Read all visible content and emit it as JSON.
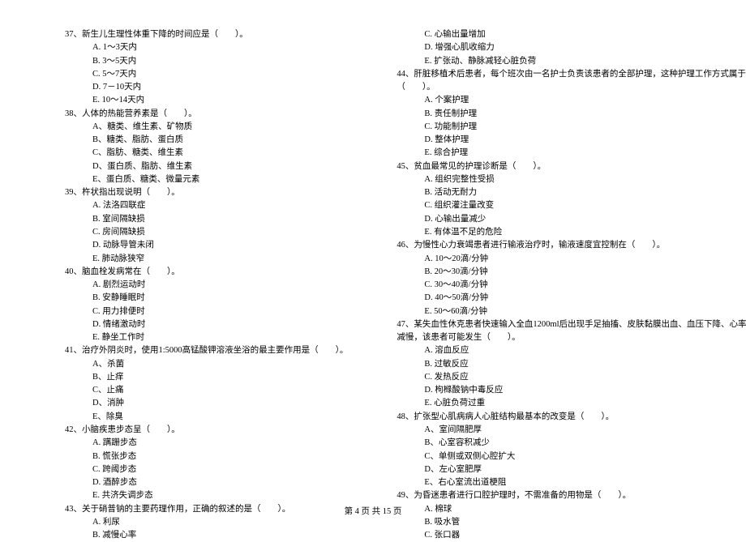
{
  "left": {
    "q37": {
      "text": "37、新生儿生理性体重下降的时间应是（　　）。",
      "opts": [
        "A. 1～3天内",
        "B. 3～5天内",
        "C. 5～7天内",
        "D. 7－10天内",
        "E. 10～14天内"
      ]
    },
    "q38": {
      "text": "38、人体的热能营养素是（　　）。",
      "opts": [
        "A、糖类、维生素、矿物质",
        "B、糖类、脂肪、蛋白质",
        "C、脂肪、糖类、维生素",
        "D、蛋白质、脂肪、维生素",
        "E、蛋白质、糖类、微量元素"
      ]
    },
    "q39": {
      "text": "39、杵状指出现说明（　　）。",
      "opts": [
        "A. 法洛四联症",
        "B. 室间隔缺损",
        "C. 房间隔缺损",
        "D. 动脉导管未闭",
        "E. 肺动脉狭窄"
      ]
    },
    "q40": {
      "text": "40、脑血栓发病常在（　　）。",
      "opts": [
        "A. 剧烈运动时",
        "B. 安静睡眠时",
        "C. 用力排便时",
        "D. 情绪激动时",
        "E. 静坐工作时"
      ]
    },
    "q41": {
      "text": "41、治疗外阴炎时，使用1:5000高锰酸钾溶液坐浴的最主要作用是（　　）。",
      "opts": [
        "A、杀菌",
        "B、止痒",
        "C、止痛",
        "D、消肿",
        "E、除臭"
      ]
    },
    "q42": {
      "text": "42、小脑疾患步态呈（　　）。",
      "opts": [
        "A. 蹒跚步态",
        "B. 慌张步态",
        "C. 跨阈步态",
        "D. 酒醉步态",
        "E. 共济失调步态"
      ]
    },
    "q43": {
      "text": "43、关于硝普钠的主要药理作用，正确的叙述的是（　　）。",
      "opts": [
        "A. 利尿",
        "B. 减慢心率"
      ]
    }
  },
  "right": {
    "q43c": [
      "C. 心输出量增加",
      "D. 增强心肌收缩力",
      "E. 扩张动、静脉减轻心脏负荷"
    ],
    "q44": {
      "text": "44、肝脏移植术后患者，每个班次由一名护士负责该患者的全部护理，这种护理工作方式属于",
      "text2": "（　　）。",
      "opts": [
        "A. 个案护理",
        "B. 责任制护理",
        "C. 功能制护理",
        "D. 整体护理",
        "E. 综合护理"
      ]
    },
    "q45": {
      "text": "45、贫血最常见的护理诊断是（　　）。",
      "opts": [
        "A. 组织完整性受损",
        "B. 活动无耐力",
        "C. 组织灌注量改变",
        "D. 心输出量减少",
        "E. 有体温不足的危险"
      ]
    },
    "q46": {
      "text": "46、为慢性心力衰竭患者进行输液治疗时，输液速度宜控制在（　　）。",
      "opts": [
        "A. 10～20滴/分钟",
        "B. 20～30滴/分钟",
        "C. 30～40滴/分钟",
        "D. 40～50滴/分钟",
        "E. 50～60滴/分钟"
      ]
    },
    "q47": {
      "text": "47、某失血性休克患者快速输入全血1200ml后出现手足抽搐、皮肤黏膜出血、血压下降、心率",
      "text2": "减慢，该患者可能发生（　　）。",
      "opts": [
        "A. 溶血反应",
        "B. 过敏反应",
        "C. 发热反应",
        "D. 枸橼酸钠中毒反应",
        "E. 心脏负荷过重"
      ]
    },
    "q48": {
      "text": "48、扩张型心肌病病人心脏结构最基本的改变是（　　）。",
      "opts": [
        "A、室间隔肥厚",
        "B、心室容积减少",
        "C、单侧或双侧心腔扩大",
        "D、左心室肥厚",
        "E、右心室流出道梗阻"
      ]
    },
    "q49": {
      "text": "49、为昏迷患者进行口腔护理时，不需准备的用物是（　　）。",
      "opts": [
        "A. 棉球",
        "B. 吸水管",
        "C. 张口器"
      ]
    }
  },
  "footer": "第 4 页 共 15 页"
}
